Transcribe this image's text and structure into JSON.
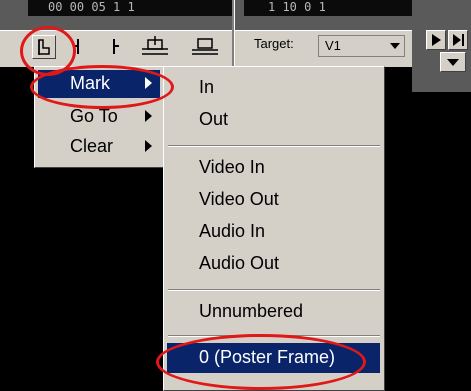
{
  "timecode_left": "00 00 05 1 1",
  "timecode_right": "1 10 0 1",
  "toolbar": {
    "icons": [
      "mark-clip-icon",
      "mark-in-icon",
      "mark-out-icon",
      "insert-edit-icon",
      "overlay-edit-icon"
    ],
    "target_label": "Target:",
    "target_value": "V1"
  },
  "menu": {
    "items": [
      {
        "label": "Mark",
        "selected": true
      },
      {
        "label": "Go To",
        "selected": false
      },
      {
        "label": "Clear",
        "selected": false
      }
    ]
  },
  "submenu": {
    "items": [
      {
        "label": "In"
      },
      {
        "label": "Out"
      },
      {
        "label": "Video In"
      },
      {
        "label": "Video Out"
      },
      {
        "label": "Audio In"
      },
      {
        "label": "Audio Out"
      },
      {
        "label": "Unnumbered"
      },
      {
        "label": "0 (Poster Frame)",
        "selected": true
      }
    ]
  },
  "colors": {
    "highlight_ring": "#e01818",
    "menu_selection": "#0a246a",
    "menu_background": "#d4d0c8"
  }
}
